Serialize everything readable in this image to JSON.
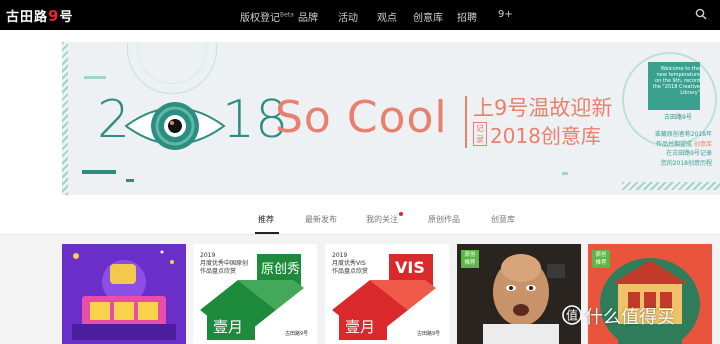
{
  "header": {
    "logo_text": "古田路",
    "logo_nine": "9",
    "logo_suffix": "号",
    "nav": [
      {
        "label": "版权登记",
        "sup": "Beta"
      },
      {
        "label": "品牌"
      },
      {
        "label": "活动"
      },
      {
        "label": "观点"
      },
      {
        "label": "创意库"
      },
      {
        "label": "招聘"
      },
      {
        "label": "9+"
      }
    ]
  },
  "banner": {
    "year_left": "2",
    "year_right": "18",
    "headline_en": "So Cool",
    "headline_cn_1": "上9号温故迎新",
    "stamp": "记录",
    "headline_cn_2": "2018创意库",
    "en_blurb": "Welcome to the new temperature on the 9th, record the \"2018 Creative Library\"",
    "brand_small": "古田路9号",
    "cn_blurb_1": "谁藏原创者称2018年",
    "cn_blurb_2a": "作品并期望成",
    "cn_blurb_2b": "创意库",
    "cn_blurb_3": "在古田路9号记录",
    "cn_blurb_4": "您的2018创意历程"
  },
  "tabs": [
    {
      "label": "推荐",
      "active": true
    },
    {
      "label": "最新发布"
    },
    {
      "label": "我的关注",
      "dot": true
    },
    {
      "label": "原创作品"
    },
    {
      "label": "创意库"
    }
  ],
  "cards": [
    {
      "name": "card-spring-festival",
      "badge": ""
    },
    {
      "name": "card-green-january",
      "year": "2019",
      "line1": "月度优秀中国原创",
      "line2": "作品盘点欣赏",
      "seal": "原创秀",
      "month": "壹月",
      "brand": "古田路9号"
    },
    {
      "name": "card-red-vis",
      "year": "2019",
      "line1": "月度优秀VIS",
      "line2": "作品盘点欣赏",
      "seal": "VIS",
      "month": "壹月",
      "brand": "古田路9号"
    },
    {
      "name": "card-chef-photo",
      "badge_1": "原创",
      "badge_2": "推荐"
    },
    {
      "name": "card-temple-illustration",
      "badge_1": "原创",
      "badge_2": "推荐"
    }
  ],
  "watermark": "什么值得买",
  "colors": {
    "teal": "#2d8d83",
    "coral": "#ea7f6c",
    "mint": "#9fd6c3",
    "brand_red": "#e8252a",
    "badge_green": "#5fb648"
  }
}
